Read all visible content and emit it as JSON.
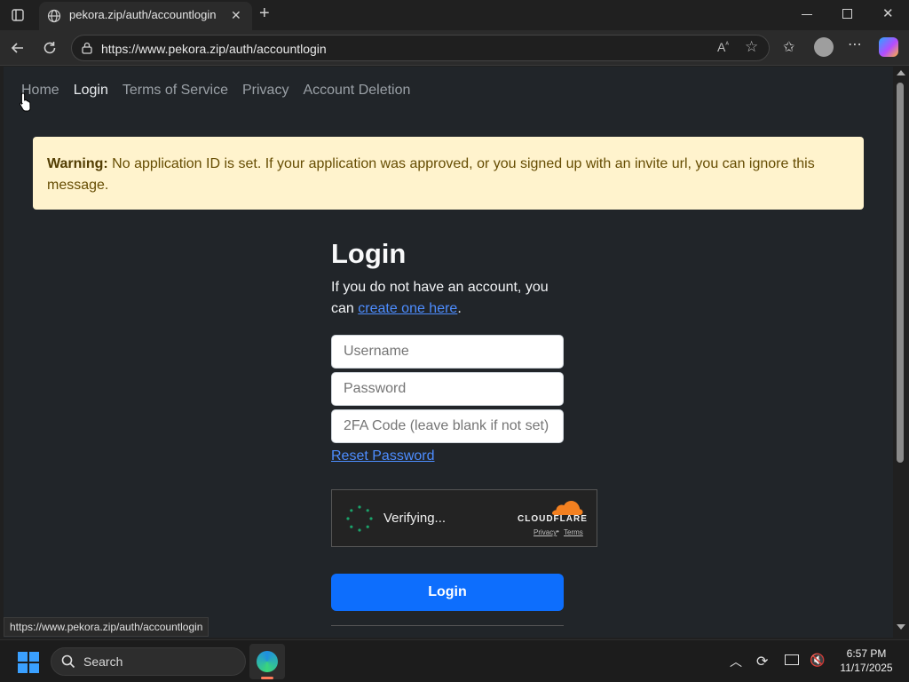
{
  "browser": {
    "tab_title": "pekora.zip/auth/accountlogin",
    "url": "https://www.pekora.zip/auth/accountlogin",
    "status_url": "https://www.pekora.zip/auth/accountlogin"
  },
  "nav": {
    "items": [
      {
        "label": "Home"
      },
      {
        "label": "Login"
      },
      {
        "label": "Terms of Service"
      },
      {
        "label": "Privacy"
      },
      {
        "label": "Account Deletion"
      }
    ]
  },
  "warning": {
    "bold": "Warning:",
    "text": " No application ID is set. If your application was approved, or you signed up with an invite url, you can ignore this message."
  },
  "login": {
    "title": "Login",
    "subtitle_pre": "If you do not have an account, you can ",
    "create_link": "create one here",
    "subtitle_post": ".",
    "username_placeholder": "Username",
    "password_placeholder": "Password",
    "twofa_placeholder": "2FA Code (leave blank if not set)",
    "reset_link": "Reset Password",
    "button": "Login"
  },
  "turnstile": {
    "status": "Verifying...",
    "brand": "CLOUDFLARE",
    "privacy": "Privacy",
    "sep": "•",
    "terms": "Terms"
  },
  "taskbar": {
    "search": "Search",
    "time": "6:57 PM",
    "date": "11/17/2025"
  },
  "colors": {
    "page_bg": "#212529",
    "warning_bg": "#fff3cd",
    "primary": "#0d6efd",
    "link": "#4d8dff",
    "cloudflare_orange": "#f38020"
  }
}
